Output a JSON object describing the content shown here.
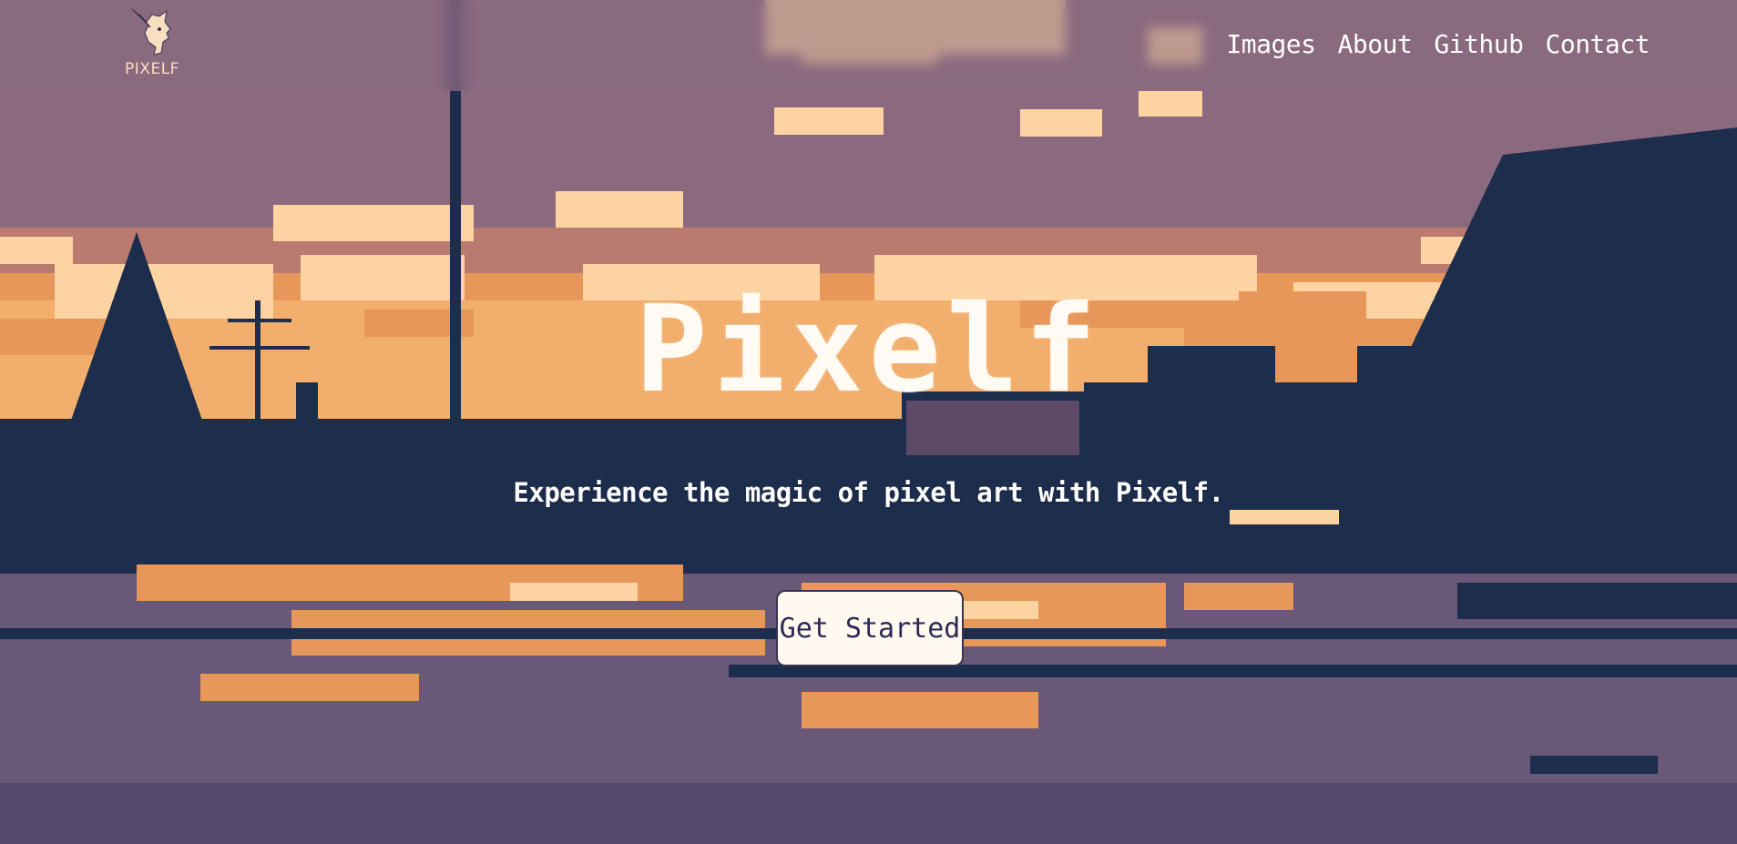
{
  "brand": {
    "logo_text": "PIXELF",
    "logo_icon": "elf-head-icon"
  },
  "nav": {
    "links": [
      "Images",
      "About",
      "Github",
      "Contact"
    ]
  },
  "hero": {
    "title": "Pixelf",
    "subtitle": "Experience the magic of pixel art with Pixelf.",
    "cta_label": "Get Started"
  },
  "colors": {
    "sky": "#8b6a7f",
    "cloud_light": "#fcd3a1",
    "cloud_orange": "#e7975a",
    "silhouette": "#1d2d4c",
    "ground_mid": "#6a5878",
    "button_bg": "#fff9ef",
    "button_text": "#2c2a55",
    "text_white": "#ffffff"
  }
}
